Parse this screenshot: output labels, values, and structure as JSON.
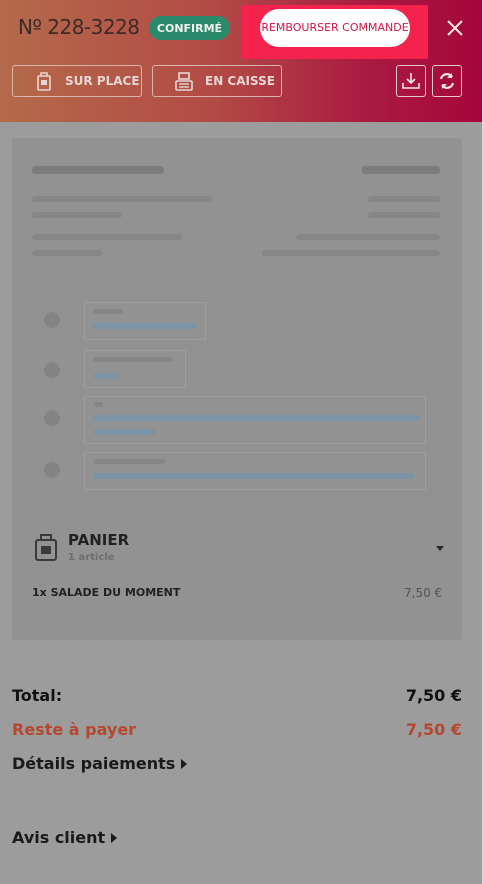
{
  "header": {
    "order_number": "Nº 228-3228",
    "status_badge": "CONFIRMÉ",
    "refund_button": "REMBOURSER COMMANDE",
    "dine_in_button": "SUR PLACE",
    "cash_button": "EN CAISSE",
    "colors": {
      "accent_red": "#f4234e",
      "badge_green": "#2a8a6b"
    }
  },
  "cart": {
    "title": "PANIER",
    "count_label": "1 article",
    "items": [
      {
        "name": "1x SALADE DU MOMENT",
        "price": "7,50 €"
      }
    ]
  },
  "totals": {
    "total_label": "Total:",
    "total_value": "7,50 €",
    "remaining_label": "Reste à payer",
    "remaining_value": "7,50 €",
    "remaining_color": "#b6472f"
  },
  "links": {
    "payment_details": "Détails paiements",
    "customer_review": "Avis client"
  },
  "icons": [
    "close-icon",
    "bag-icon",
    "register-icon",
    "download-icon",
    "refresh-icon",
    "chevron-down-icon",
    "chevron-right-icon"
  ]
}
